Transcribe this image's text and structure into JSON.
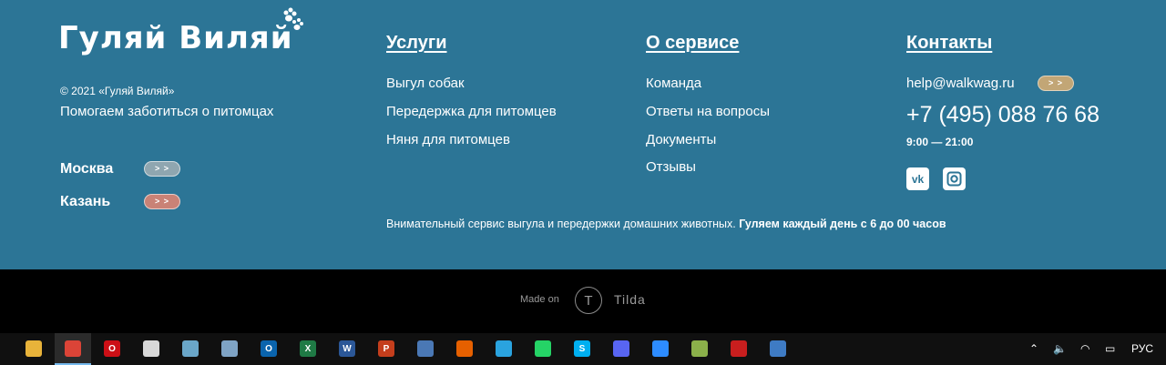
{
  "brand": {
    "name": "Гуляй Виляй",
    "copyright": "© 2021 «Гуляй Виляй»",
    "tagline": "Помогаем заботиться о питомцах"
  },
  "cities": [
    {
      "name": "Москва",
      "button": "> >",
      "color": "#8fa6b0"
    },
    {
      "name": "Казань",
      "button": "> >",
      "color": "#c98276"
    }
  ],
  "services": {
    "title": "Услуги",
    "items": [
      "Выгул собак",
      "Передержка для питомцев",
      "Няня для питомцев"
    ]
  },
  "about": {
    "title": "О сервисе",
    "items": [
      "Команда",
      "Ответы на вопросы",
      "Документы",
      "Отзывы"
    ]
  },
  "contacts": {
    "title": "Контакты",
    "email": "help@walkwag.ru",
    "email_button": "> >",
    "phone": "+7 (495) 088 76 68",
    "hours": "9:00 — 21:00",
    "social": [
      "vk-icon",
      "instagram-icon"
    ]
  },
  "note": {
    "text": "Внимательный сервис выгула и передержки домашних животных.",
    "bold": "Гуляем каждый день с 6 до 00 часов"
  },
  "made": {
    "made_on": "Made on",
    "tilda": "Tilda",
    "logo_letter": "T"
  },
  "taskbar": {
    "apps": [
      {
        "name": "file-explorer-icon",
        "glyph": "",
        "color": "#e8b33a"
      },
      {
        "name": "chrome-icon",
        "glyph": "",
        "color": "#db4437"
      },
      {
        "name": "opera-icon",
        "glyph": "O",
        "color": "#cc0f16"
      },
      {
        "name": "paint-icon",
        "glyph": "",
        "color": "#d8d8d8"
      },
      {
        "name": "notes-icon",
        "glyph": "",
        "color": "#6aa6c8"
      },
      {
        "name": "calculator-icon",
        "glyph": "",
        "color": "#7fa3c4"
      },
      {
        "name": "outlook-icon",
        "glyph": "O",
        "color": "#0a64ad"
      },
      {
        "name": "excel-icon",
        "glyph": "X",
        "color": "#1f7a45"
      },
      {
        "name": "word-icon",
        "glyph": "W",
        "color": "#2b5797"
      },
      {
        "name": "powerpoint-icon",
        "glyph": "P",
        "color": "#c43e1c"
      },
      {
        "name": "network-icon",
        "glyph": "",
        "color": "#4a78b5"
      },
      {
        "name": "firefox-icon",
        "glyph": "",
        "color": "#e66000"
      },
      {
        "name": "telegram-icon",
        "glyph": "",
        "color": "#2aa3df"
      },
      {
        "name": "whatsapp-icon",
        "glyph": "",
        "color": "#25d366"
      },
      {
        "name": "skype-icon",
        "glyph": "S",
        "color": "#00aff0"
      },
      {
        "name": "discord-icon",
        "glyph": "",
        "color": "#5865f2"
      },
      {
        "name": "zoom-icon",
        "glyph": "",
        "color": "#2d8cff"
      },
      {
        "name": "image-viewer-icon",
        "glyph": "",
        "color": "#8bb04a"
      },
      {
        "name": "acrobat-icon",
        "glyph": "",
        "color": "#c81e1e"
      },
      {
        "name": "app-icon",
        "glyph": "",
        "color": "#3e7bc4"
      }
    ],
    "lang": "РУС"
  }
}
